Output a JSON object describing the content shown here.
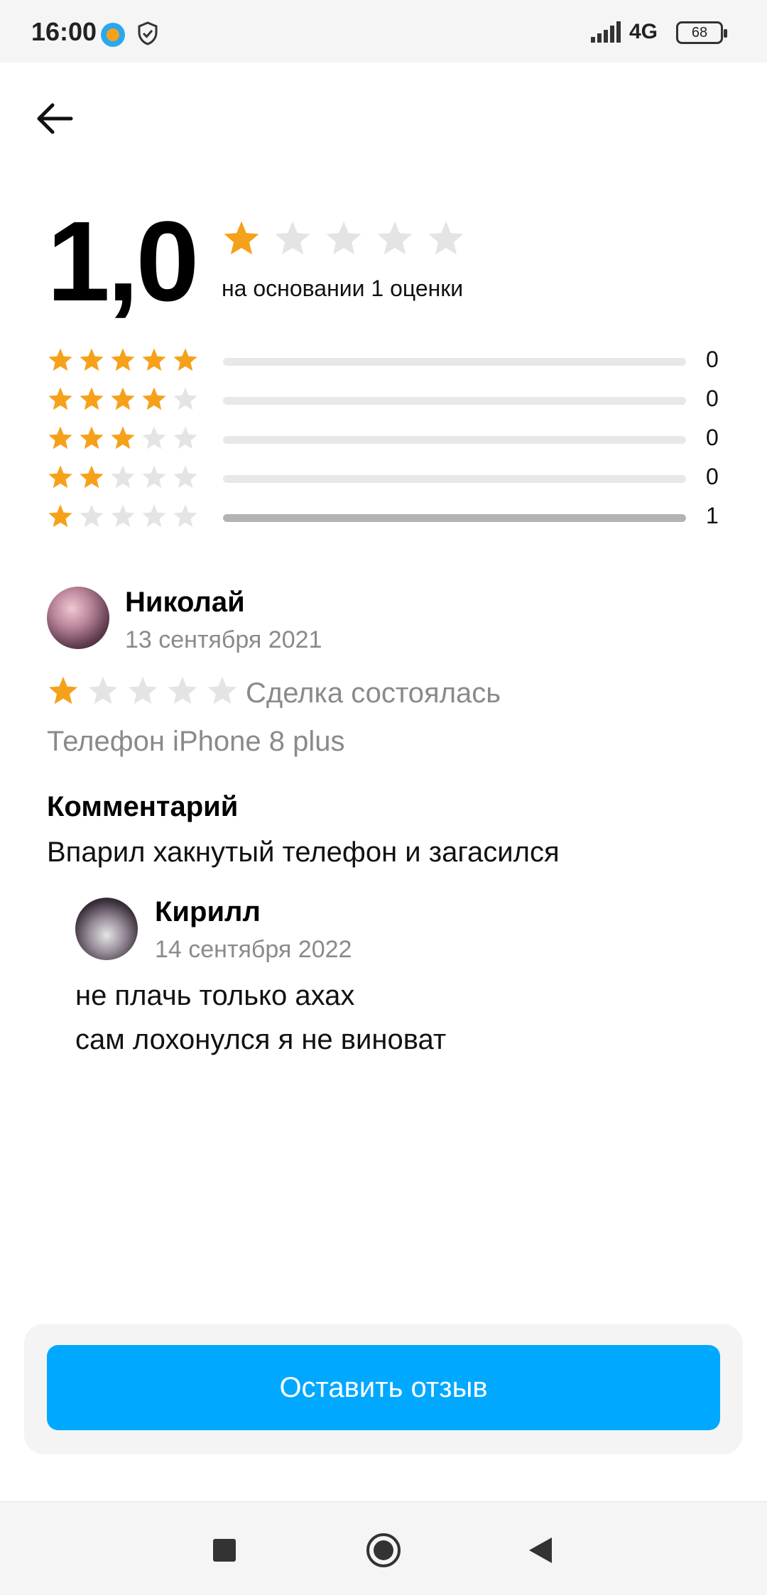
{
  "status_bar": {
    "time": "16:00",
    "network": "4G",
    "battery": "68"
  },
  "colors": {
    "star_filled": "#f6a11a",
    "star_empty": "#e4e4e4",
    "accent": "#00a8ff",
    "muted_text": "#8a8a8a"
  },
  "summary": {
    "score": "1,0",
    "stars_filled": 1,
    "caption": "на основании 1 оценки"
  },
  "distribution": [
    {
      "stars": 5,
      "count": "0",
      "fraction": 0
    },
    {
      "stars": 4,
      "count": "0",
      "fraction": 0
    },
    {
      "stars": 3,
      "count": "0",
      "fraction": 0
    },
    {
      "stars": 2,
      "count": "0",
      "fraction": 0
    },
    {
      "stars": 1,
      "count": "1",
      "fraction": 1
    }
  ],
  "review": {
    "author": "Николай",
    "date": "13 сентября 2021",
    "stars_filled": 1,
    "deal_status": "Сделка состоялась",
    "item": "Телефон iPhone 8 plus",
    "comment_heading": "Комментарий",
    "comment": "Впарил хакнутый телефон и загасился",
    "reply": {
      "author": "Кирилл",
      "date": "14 сентября 2022",
      "lines": [
        "не плачь только ахах",
        "сам лохонулся я не виноват"
      ]
    }
  },
  "action": {
    "leave_review_label": "Оставить отзыв"
  }
}
